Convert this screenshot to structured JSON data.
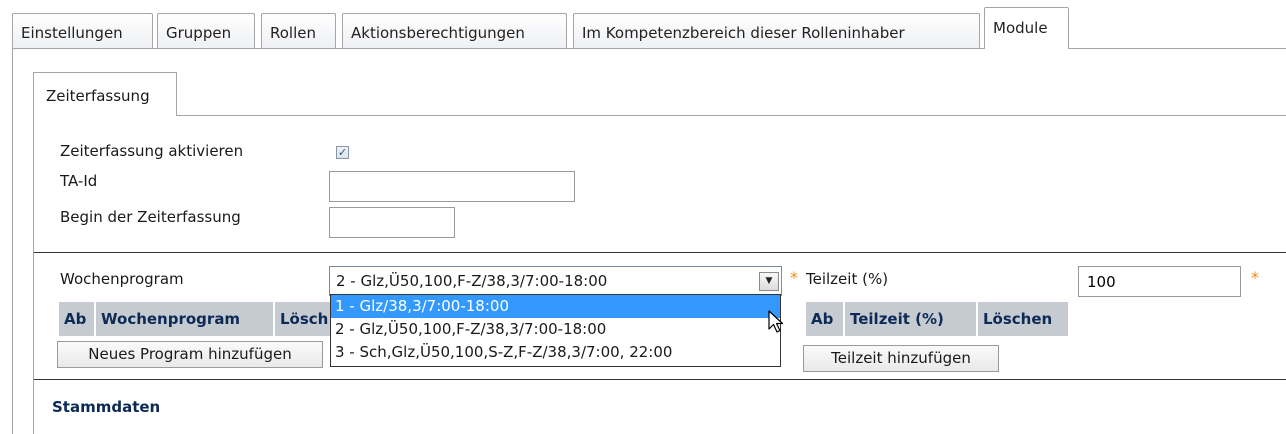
{
  "top_tabs": [
    {
      "label": "Einstellungen",
      "active": false
    },
    {
      "label": "Gruppen",
      "active": false
    },
    {
      "label": "Rollen",
      "active": false
    },
    {
      "label": "Aktionsberechtigungen",
      "active": false
    },
    {
      "label": "Im Kompetenzbereich dieser Rolleninhaber",
      "active": false
    },
    {
      "label": "Module",
      "active": true
    }
  ],
  "sub_tab": {
    "label": "Zeiterfassung"
  },
  "form": {
    "zeiterfassung_label": "Zeiterfassung aktivieren",
    "zeiterfassung_checked": true,
    "checkmark": "✓",
    "ta_id_label": "TA-Id",
    "ta_id_value": "",
    "begin_label": "Begin der Zeiterfassung",
    "begin_value": ""
  },
  "wochenprogram": {
    "label": "Wochenprogram",
    "selected": "2 - Glz,Ü50,100,F-Z/38,3/7:00-18:00",
    "required_marker": "*",
    "options": [
      {
        "label": "1 - Glz/38,3/7:00-18:00",
        "highlighted": true
      },
      {
        "label": "2 - Glz,Ü50,100,F-Z/38,3/7:00-18:00",
        "highlighted": false
      },
      {
        "label": "3 - Sch,Glz,Ü50,100,S-Z,F-Z/38,3/7:00, 22:00",
        "highlighted": false
      }
    ],
    "table_headers": [
      "Ab",
      "Wochenprogram",
      "Lösch"
    ],
    "add_button": "Neues Program hinzufügen"
  },
  "teilzeit": {
    "label": "Teilzeit (%)",
    "value": "100",
    "required_marker": "*",
    "table_headers": [
      "Ab",
      "Teilzeit (%)",
      "Löschen"
    ],
    "add_button": "Teilzeit hinzufügen"
  },
  "section": {
    "stammdaten": "Stammdaten"
  },
  "colors": {
    "header_bg": "#c6cbd2",
    "header_text": "#0d2a55",
    "highlight": "#3399ff",
    "required": "#f08a1c"
  }
}
